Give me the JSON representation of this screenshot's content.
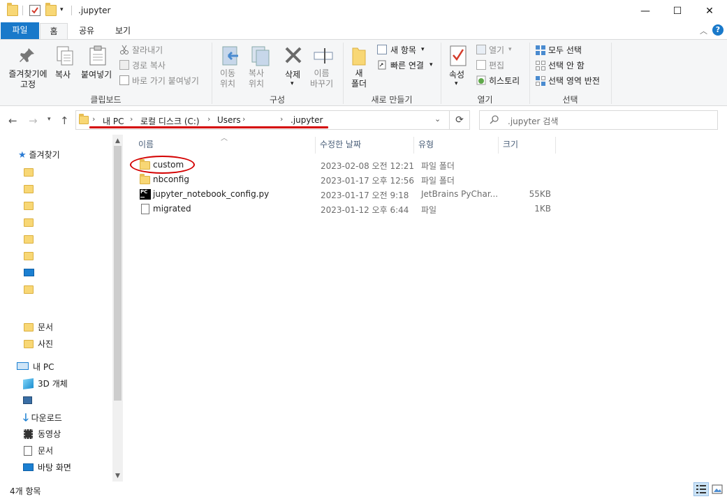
{
  "window": {
    "title": ".jupyter",
    "minimize": "—",
    "maximize": "☐",
    "close": "✕"
  },
  "tabs": {
    "file": "파일",
    "home": "홈",
    "share": "공유",
    "view": "보기",
    "help": "?"
  },
  "ribbon": {
    "clipboard": {
      "pin_line1": "즐겨찾기에",
      "pin_line2": "고정",
      "copy": "복사",
      "paste": "붙여넣기",
      "cut": "잘라내기",
      "copy_path": "경로 복사",
      "paste_shortcut": "바로 가기 붙여넣기",
      "label": "클립보드"
    },
    "organize": {
      "move_line1": "이동",
      "move_line2": "위치",
      "copyto_line1": "복사",
      "copyto_line2": "위치",
      "delete": "삭제",
      "rename_line1": "이름",
      "rename_line2": "바꾸기",
      "label": "구성"
    },
    "new": {
      "folder_line1": "새",
      "folder_line2": "폴더",
      "new_item": "새 항목",
      "easy_access": "빠른 연결",
      "label": "새로 만들기"
    },
    "open": {
      "properties": "속성",
      "open": "열기",
      "edit": "편집",
      "history": "히스토리",
      "label": "열기"
    },
    "select": {
      "select_all": "모두 선택",
      "select_none": "선택 안 함",
      "invert": "선택 영역 반전",
      "label": "선택"
    }
  },
  "address": {
    "crumbs": [
      "내 PC",
      "로컬 디스크 (C:)",
      "Users",
      "",
      ".jupyter"
    ],
    "search_placeholder": ".jupyter 검색"
  },
  "nav": {
    "quick_access": "즐겨찾기",
    "documents": "문서",
    "pictures": "사진",
    "this_pc": "내 PC",
    "objects3d": "3D 개체",
    "downloads": "다운로드",
    "videos": "동영상",
    "documents2": "문서",
    "desktop": "바탕 화면"
  },
  "columns": {
    "name": "이름",
    "date": "수정한 날짜",
    "type": "유형",
    "size": "크기"
  },
  "files": [
    {
      "name": "custom",
      "date": "2023-02-08 오전 12:21",
      "type": "파일 폴더",
      "size": "",
      "icon": "folder-icon"
    },
    {
      "name": "nbconfig",
      "date": "2023-01-17 오후 12:56",
      "type": "파일 폴더",
      "size": "",
      "icon": "folder-icon"
    },
    {
      "name": "jupyter_notebook_config.py",
      "date": "2023-01-17 오전 9:18",
      "type": "JetBrains PyChar...",
      "size": "55KB",
      "icon": "pycharm-file-icon"
    },
    {
      "name": "migrated",
      "date": "2023-01-12 오후 6:44",
      "type": "파일",
      "size": "1KB",
      "icon": "blank-file-icon"
    }
  ],
  "status": {
    "item_count": "4개 항목"
  }
}
